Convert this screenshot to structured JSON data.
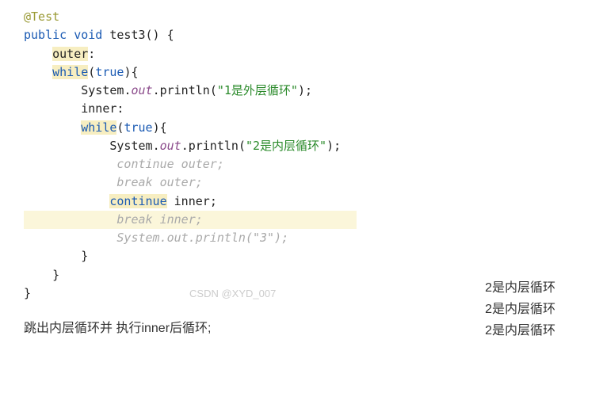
{
  "code": {
    "annotation": "@Test",
    "kw_public": "public",
    "kw_void": "void",
    "method_name": "test3",
    "paren_open": "()",
    "brace_open": "{",
    "outer_label": "outer",
    "colon": ":",
    "kw_while": "while",
    "true_lit": "true",
    "sys": "System",
    "out": "out",
    "println": "println",
    "str1": "\"1是外层循环\"",
    "inner_label": "inner",
    "str2": "\"2是内层循环\"",
    "cont_outer": "continue outer;",
    "break_outer": "break outer;",
    "kw_continue": "continue",
    "inner_ref": "inner",
    "semi": ";",
    "break_inner": "break inner;",
    "sys_comment": "System.out.println(\"3\");",
    "brace_close": "}",
    "watermark": "CSDN @XYD_007"
  },
  "output": {
    "l1": "2是内层循环",
    "l2": "2是内层循环",
    "l3": "2是内层循环"
  },
  "caption": "跳出内层循环并 执行inner后循环;"
}
